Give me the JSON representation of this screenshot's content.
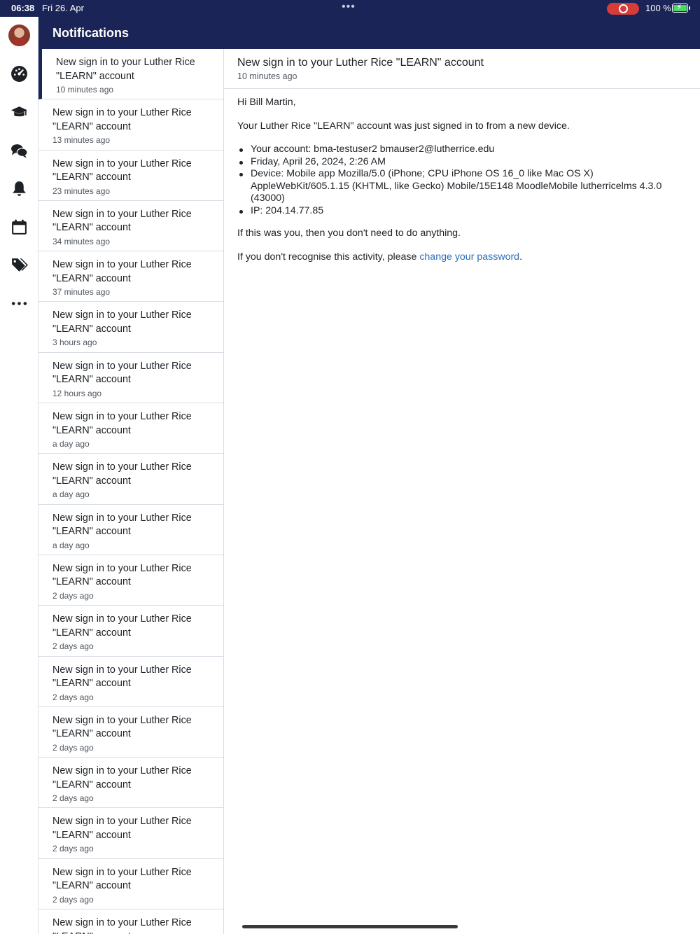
{
  "status_bar": {
    "time": "06:38",
    "date": "Fri 26. Apr",
    "dots": "•••",
    "battery_pct": "100 %"
  },
  "header": {
    "title": "Notifications"
  },
  "sidenav": {
    "items": [
      "avatar",
      "dashboard-icon",
      "courses-icon",
      "messages-icon",
      "notifications-icon",
      "calendar-icon",
      "tags-icon",
      "more-icon"
    ]
  },
  "list": {
    "items": [
      {
        "title": "New sign in to your Luther Rice \"LEARN\" account",
        "time": "10 minutes ago"
      },
      {
        "title": "New sign in to your Luther Rice \"LEARN\" account",
        "time": "13 minutes ago"
      },
      {
        "title": "New sign in to your Luther Rice \"LEARN\" account",
        "time": "23 minutes ago"
      },
      {
        "title": "New sign in to your Luther Rice \"LEARN\" account",
        "time": "34 minutes ago"
      },
      {
        "title": "New sign in to your Luther Rice \"LEARN\" account",
        "time": "37 minutes ago"
      },
      {
        "title": "New sign in to your Luther Rice \"LEARN\" account",
        "time": "3 hours ago"
      },
      {
        "title": "New sign in to your Luther Rice \"LEARN\" account",
        "time": "12 hours ago"
      },
      {
        "title": "New sign in to your Luther Rice \"LEARN\" account",
        "time": "a day ago"
      },
      {
        "title": "New sign in to your Luther Rice \"LEARN\" account",
        "time": "a day ago"
      },
      {
        "title": "New sign in to your Luther Rice \"LEARN\" account",
        "time": "a day ago"
      },
      {
        "title": "New sign in to your Luther Rice \"LEARN\" account",
        "time": "2 days ago"
      },
      {
        "title": "New sign in to your Luther Rice \"LEARN\" account",
        "time": "2 days ago"
      },
      {
        "title": "New sign in to your Luther Rice \"LEARN\" account",
        "time": "2 days ago"
      },
      {
        "title": "New sign in to your Luther Rice \"LEARN\" account",
        "time": "2 days ago"
      },
      {
        "title": "New sign in to your Luther Rice \"LEARN\" account",
        "time": "2 days ago"
      },
      {
        "title": "New sign in to your Luther Rice \"LEARN\" account",
        "time": "2 days ago"
      },
      {
        "title": "New sign in to your Luther Rice \"LEARN\" account",
        "time": "2 days ago"
      },
      {
        "title": "New sign in to your Luther Rice \"LEARN\" account",
        "time": ""
      }
    ]
  },
  "detail": {
    "title": "New sign in to your Luther Rice \"LEARN\" account",
    "time": "10 minutes ago",
    "greeting": "Hi Bill Martin,",
    "intro": "Your Luther Rice \"LEARN\" account was just signed in to from a new device.",
    "bullets": [
      "Your account: bma-testuser2 bmauser2@lutherrice.edu",
      "Friday, April 26, 2024, 2:26 AM",
      "Device: Mobile app Mozilla/5.0 (iPhone; CPU iPhone OS 16_0 like Mac OS X) AppleWebKit/605.1.15 (KHTML, like Gecko) Mobile/15E148 MoodleMobile lutherricelms 4.3.0 (43000)",
      "IP: 204.14.77.85"
    ],
    "if_you": "If this was you, then you don't need to do anything.",
    "recognise_prefix": "If you don't recognise this activity, please ",
    "recognise_link": "change your password",
    "recognise_suffix": "."
  },
  "colors": {
    "brand_navy": "#1a2456",
    "link_blue": "#2a6db5",
    "record_red": "#d63c3a",
    "battery_green": "#4cd964"
  }
}
